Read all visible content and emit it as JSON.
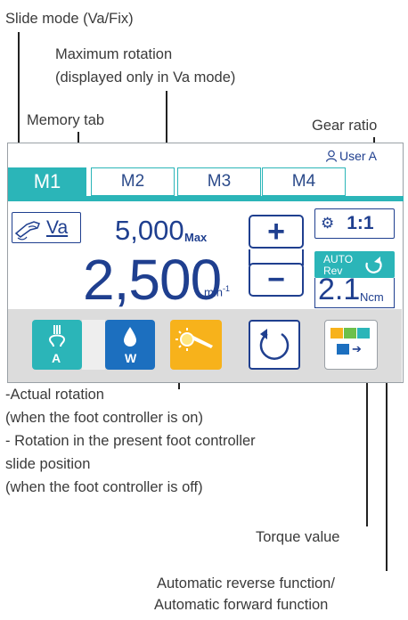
{
  "annotations": {
    "slide_mode": "Slide mode (Va/Fix)",
    "max_rotation_l1": "Maximum rotation",
    "max_rotation_l2": "(displayed only in Va mode)",
    "memory_tab": "Memory tab",
    "gear_ratio": "Gear ratio",
    "actual_rotation": [
      "-Actual rotation",
      "(when the foot controller is on)",
      "- Rotation in the present foot controller",
      "slide position",
      "(when the foot controller is off)"
    ],
    "torque_value": "Torque value",
    "auto_reverse_l1": "Automatic reverse function/",
    "auto_reverse_l2": "Automatic forward  function"
  },
  "device": {
    "user": "User A",
    "tabs": [
      "M1",
      "M2",
      "M3",
      "M4"
    ],
    "active_tab": "M1",
    "slide_mode": "Va",
    "max_rotation": "5,000",
    "max_label": "Max",
    "rotation": "2,500",
    "rotation_unit": "min",
    "rotation_unit_exp": "-1",
    "plus_label": "+",
    "minus_label": "−",
    "gear_ratio": "1:1",
    "auto_label": "AUTO",
    "rev_label": "Rev",
    "torque": "2.1",
    "torque_unit": "Ncm",
    "air_label": "A",
    "water_label": "W",
    "colors": {
      "teal": "#2bb5b8",
      "navy": "#1f3f8f",
      "water": "#1c6fbf",
      "light": "#f7b21b"
    }
  }
}
